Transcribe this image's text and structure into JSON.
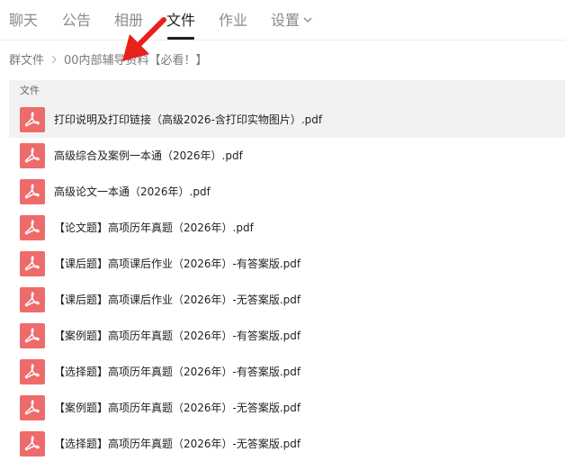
{
  "tabs": [
    {
      "label": "聊天"
    },
    {
      "label": "公告"
    },
    {
      "label": "相册"
    },
    {
      "label": "文件"
    },
    {
      "label": "作业"
    },
    {
      "label": "设置"
    }
  ],
  "breadcrumb": {
    "root": "群文件",
    "current": "00内部辅导资料【必看！】"
  },
  "section_header": "文件",
  "files": [
    {
      "name": "打印说明及打印链接（高级2026-含打印实物图片）.pdf"
    },
    {
      "name": "高级综合及案例一本通（2026年）.pdf"
    },
    {
      "name": "高级论文一本通（2026年）.pdf"
    },
    {
      "name": "【论文题】高项历年真题（2026年）.pdf"
    },
    {
      "name": "【课后题】高项课后作业（2026年）-有答案版.pdf"
    },
    {
      "name": "【课后题】高项课后作业（2026年）-无答案版.pdf"
    },
    {
      "name": "【案例题】高项历年真题（2026年）-有答案版.pdf"
    },
    {
      "name": "【选择题】高项历年真题（2026年）-有答案版.pdf"
    },
    {
      "name": "【案例题】高项历年真题（2026年）-无答案版.pdf"
    },
    {
      "name": "【选择题】高项历年真题（2026年）-无答案版.pdf"
    }
  ],
  "colors": {
    "pdf_icon": "#ee6b6b",
    "annotation_arrow": "#e8211b",
    "active_tab": "#1f1f1f",
    "inactive_tab": "#8a8a8a"
  },
  "icons": {
    "file_type": "pdf-icon",
    "settings_dropdown": "chevron-down-icon",
    "breadcrumb_separator": "chevron-right-icon"
  }
}
